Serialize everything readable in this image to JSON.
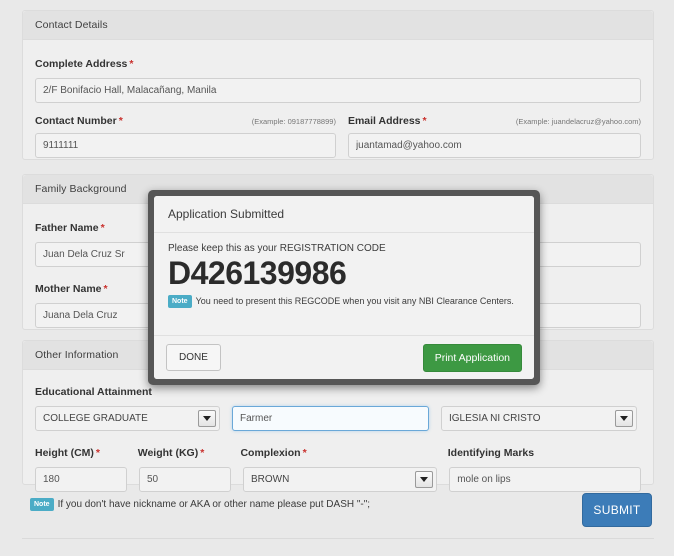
{
  "sections": {
    "contact": {
      "title": "Contact Details",
      "address": {
        "label": "Complete Address",
        "required": "*",
        "value": "2/F Bonifacio Hall, Malacañang, Manila"
      },
      "contact_number": {
        "label": "Contact Number",
        "required": "*",
        "hint": "(Example: 09187778899)",
        "value": "9111111"
      },
      "email": {
        "label": "Email Address",
        "required": "*",
        "hint": "(Example: juandelacruz@yahoo.com)",
        "value": "juantamad@yahoo.com"
      }
    },
    "family": {
      "title": "Family Background",
      "father": {
        "label": "Father Name",
        "required": "*",
        "value": "Juan Dela Cruz Sr"
      },
      "mother": {
        "label": "Mother Name",
        "required": "*",
        "value": "Juana Dela Cruz"
      }
    },
    "other": {
      "title": "Other Information",
      "education": {
        "label": "Educational Attainment",
        "value": "COLLEGE GRADUATE"
      },
      "occupation": {
        "value": "Farmer"
      },
      "religion": {
        "value": "IGLESIA NI CRISTO"
      },
      "height": {
        "label": "Height (CM)",
        "required": "*",
        "value": "180"
      },
      "weight": {
        "label": "Weight (KG)",
        "required": "*",
        "value": "50"
      },
      "complexion": {
        "label": "Complexion",
        "required": "*",
        "value": "BROWN"
      },
      "marks": {
        "label": "Identifying Marks",
        "value": "mole on lips"
      }
    }
  },
  "footer": {
    "note_badge": "Note",
    "note_text": "If you don't have nickname or AKA or other name please put DASH \"-\";",
    "submit_label": "SUBMIT"
  },
  "modal": {
    "title": "Application Submitted",
    "subtitle": "Please keep this as your REGISTRATION CODE",
    "registration_code": "D426139986",
    "note_badge": "Note",
    "note_text": "You need to present this REGCODE when you visit any NBI Clearance Centers.",
    "done_label": "DONE",
    "print_label": "Print Application"
  },
  "colors": {
    "submit_blue": "#3c7cb8",
    "print_green": "#3d9943",
    "note_teal": "#4bacc6",
    "required_red": "#c9302c",
    "modal_border": "#565656",
    "focus_blue": "#6aa8d8"
  },
  "icons": {
    "dropdown": "chevron-down-icon"
  }
}
